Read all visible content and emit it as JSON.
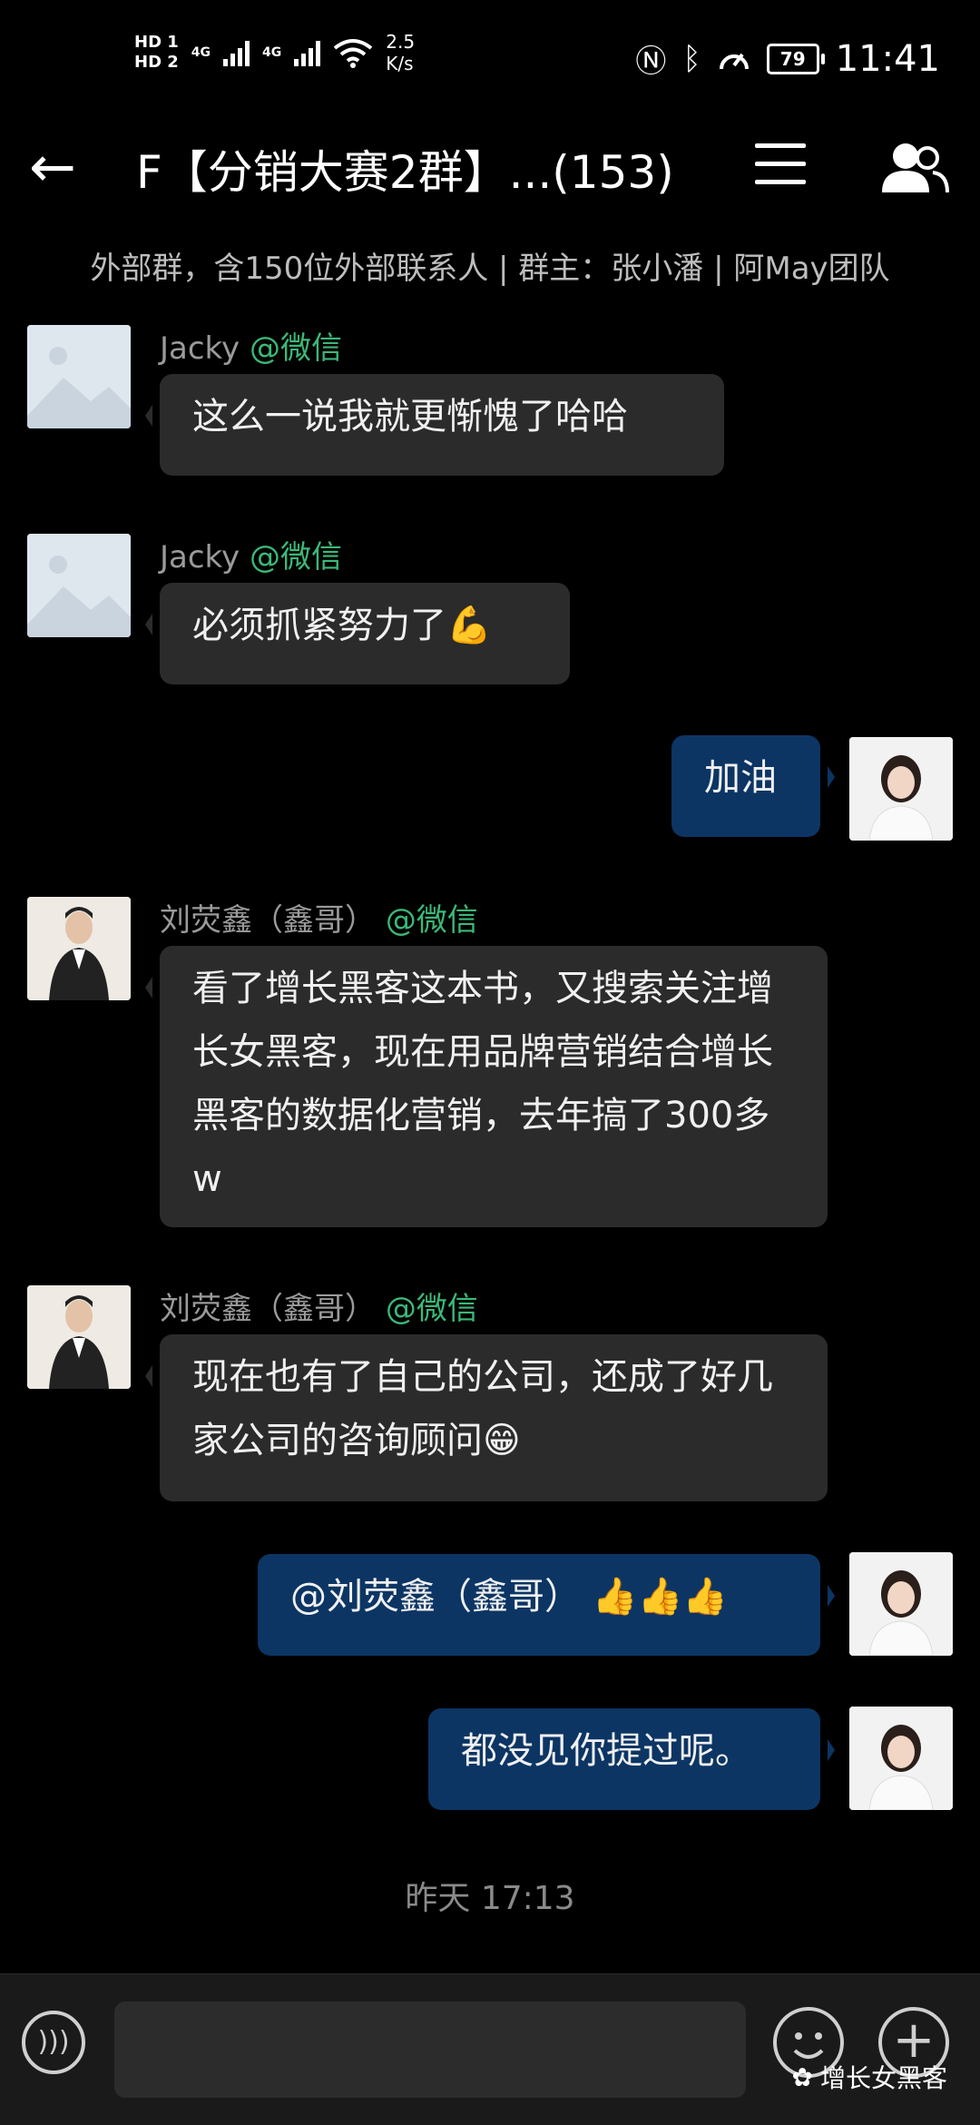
{
  "status_bar": {
    "hd1": "HD 1",
    "hd2": "HD 2",
    "sig1": "4G",
    "sig2": "4G",
    "speed_value": "2.5",
    "speed_unit": "K/s",
    "battery": "79",
    "time": "11:41"
  },
  "header": {
    "title": "F【分销大赛2群】...(153)"
  },
  "group_info": "外部群，含150位外部联系人 | 群主：张小潘 | 阿May团队",
  "messages": [
    {
      "sender": "Jacky",
      "source": "@微信",
      "text": "这么一说我就更惭愧了哈哈"
    },
    {
      "sender": "Jacky",
      "source": "@微信",
      "text": "必须抓紧努力了",
      "emoji": "💪"
    },
    {
      "text": "加油"
    },
    {
      "sender": "刘荧鑫（鑫哥）",
      "source": "@微信",
      "text": "看了增长黑客这本书，又搜索关注增长女黑客，现在用品牌营销结合增长黑客的数据化营销，去年搞了300多w"
    },
    {
      "sender": "刘荧鑫（鑫哥）",
      "source": "@微信",
      "text": "现在也有了自己的公司，还成了好几家公司的咨询顾问",
      "emoji": "😁"
    },
    {
      "text": "@刘荧鑫（鑫哥）",
      "emoji": "👍👍👍"
    },
    {
      "text": "都没见你提过呢。"
    }
  ],
  "timestamp": "昨天  17:13",
  "input": {
    "placeholder": ""
  },
  "watermark": "增长女黑客"
}
